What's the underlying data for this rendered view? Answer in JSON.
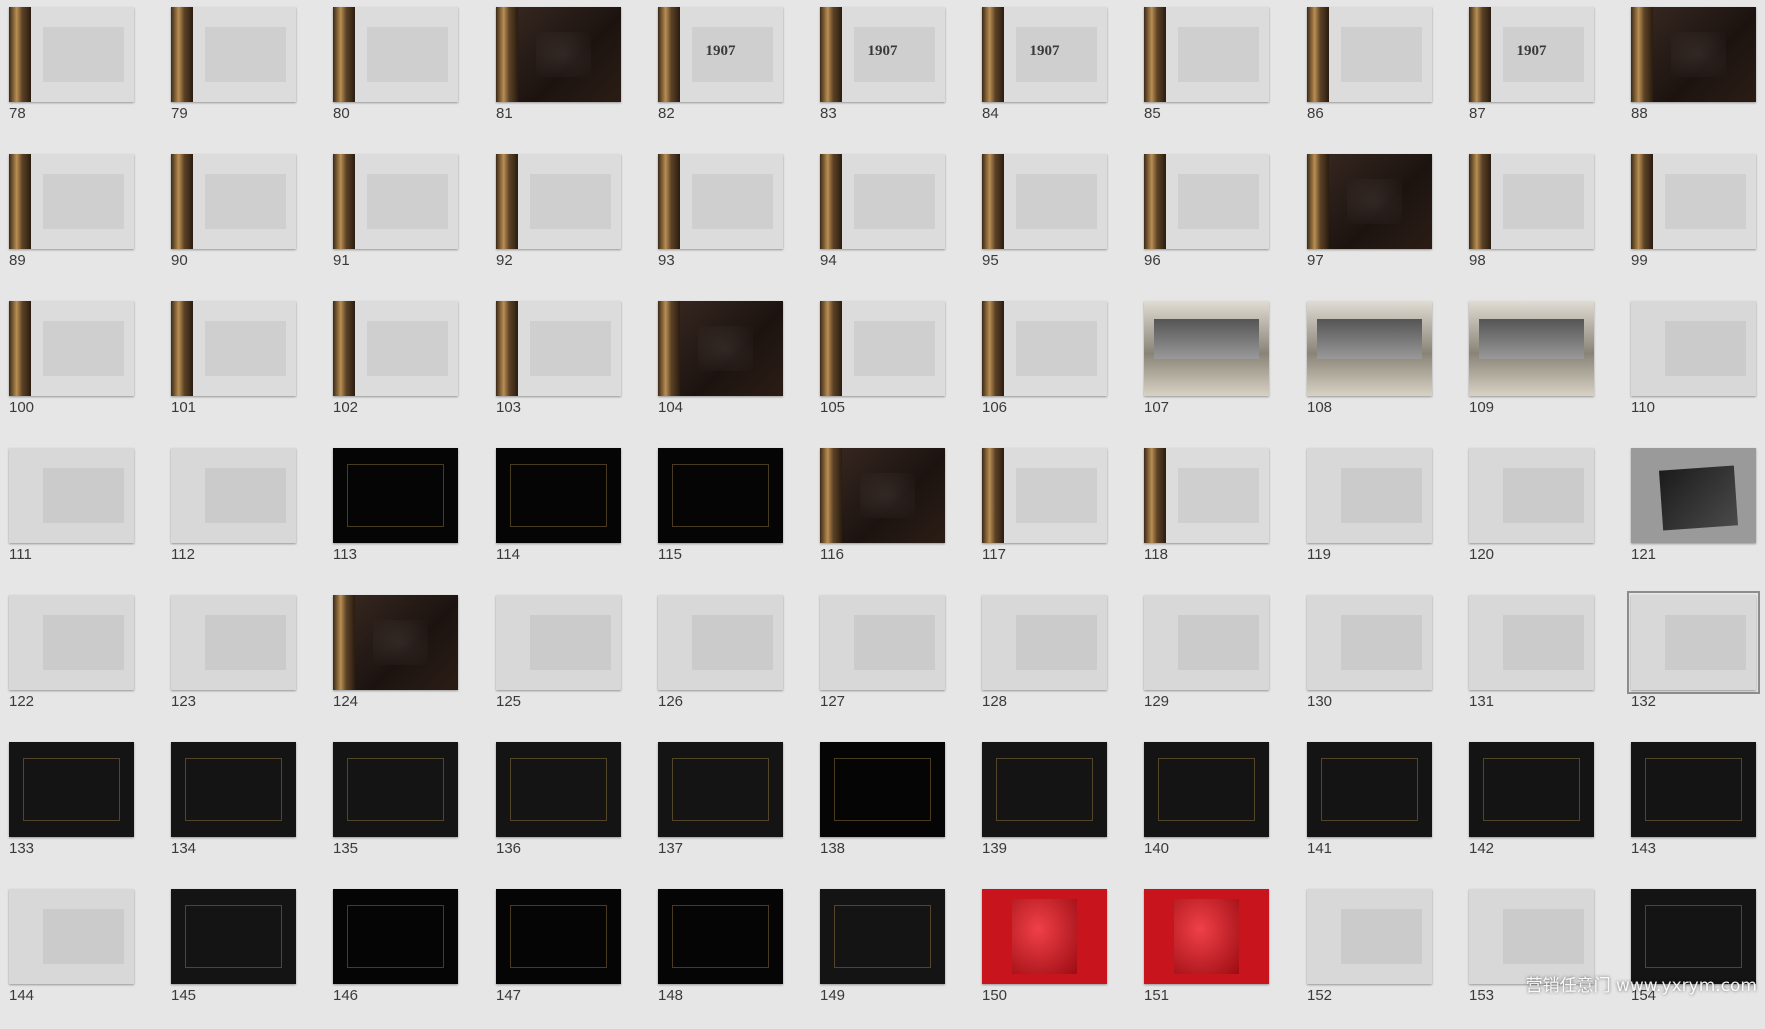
{
  "watermark": "营销任意门 www.yxrym.com",
  "selected": "132",
  "slides": [
    {
      "n": "78",
      "theme": "gold-light",
      "label": ""
    },
    {
      "n": "79",
      "theme": "gold-light",
      "label": ""
    },
    {
      "n": "80",
      "theme": "gold-light",
      "label": ""
    },
    {
      "n": "81",
      "theme": "gold-dark",
      "label": ""
    },
    {
      "n": "82",
      "theme": "gold-light",
      "label": "1907"
    },
    {
      "n": "83",
      "theme": "gold-light",
      "label": "1907"
    },
    {
      "n": "84",
      "theme": "gold-light",
      "label": "1907"
    },
    {
      "n": "85",
      "theme": "gold-light",
      "label": ""
    },
    {
      "n": "86",
      "theme": "gold-light",
      "label": ""
    },
    {
      "n": "87",
      "theme": "gold-light",
      "label": "1907"
    },
    {
      "n": "88",
      "theme": "gold-dark",
      "label": ""
    },
    {
      "n": "89",
      "theme": "gold-light",
      "label": ""
    },
    {
      "n": "90",
      "theme": "gold-light",
      "label": ""
    },
    {
      "n": "91",
      "theme": "gold-light",
      "label": ""
    },
    {
      "n": "92",
      "theme": "gold-light",
      "label": ""
    },
    {
      "n": "93",
      "theme": "gold-light",
      "label": ""
    },
    {
      "n": "94",
      "theme": "gold-light",
      "label": ""
    },
    {
      "n": "95",
      "theme": "gold-light",
      "label": ""
    },
    {
      "n": "96",
      "theme": "gold-light",
      "label": ""
    },
    {
      "n": "97",
      "theme": "gold-dark",
      "label": ""
    },
    {
      "n": "98",
      "theme": "gold-light",
      "label": ""
    },
    {
      "n": "99",
      "theme": "gold-light",
      "label": ""
    },
    {
      "n": "100",
      "theme": "gold-light",
      "label": ""
    },
    {
      "n": "101",
      "theme": "gold-light",
      "label": ""
    },
    {
      "n": "102",
      "theme": "gold-light",
      "label": ""
    },
    {
      "n": "103",
      "theme": "gold-light",
      "label": ""
    },
    {
      "n": "104",
      "theme": "gold-dark",
      "label": ""
    },
    {
      "n": "105",
      "theme": "gold-light",
      "label": ""
    },
    {
      "n": "106",
      "theme": "gold-light",
      "label": ""
    },
    {
      "n": "107",
      "theme": "city",
      "label": ""
    },
    {
      "n": "108",
      "theme": "city",
      "label": ""
    },
    {
      "n": "109",
      "theme": "city",
      "label": ""
    },
    {
      "n": "110",
      "theme": "light",
      "label": ""
    },
    {
      "n": "111",
      "theme": "light",
      "label": ""
    },
    {
      "n": "112",
      "theme": "light",
      "label": ""
    },
    {
      "n": "113",
      "theme": "black",
      "label": ""
    },
    {
      "n": "114",
      "theme": "black",
      "label": ""
    },
    {
      "n": "115",
      "theme": "black",
      "label": ""
    },
    {
      "n": "116",
      "theme": "gold-dark",
      "label": ""
    },
    {
      "n": "117",
      "theme": "gold-light",
      "label": ""
    },
    {
      "n": "118",
      "theme": "gold-light",
      "label": ""
    },
    {
      "n": "119",
      "theme": "light",
      "label": ""
    },
    {
      "n": "120",
      "theme": "light",
      "label": ""
    },
    {
      "n": "121",
      "theme": "grey",
      "label": ""
    },
    {
      "n": "122",
      "theme": "light",
      "label": ""
    },
    {
      "n": "123",
      "theme": "light",
      "label": ""
    },
    {
      "n": "124",
      "theme": "gold-dark",
      "label": ""
    },
    {
      "n": "125",
      "theme": "light",
      "label": ""
    },
    {
      "n": "126",
      "theme": "light",
      "label": ""
    },
    {
      "n": "127",
      "theme": "light",
      "label": ""
    },
    {
      "n": "128",
      "theme": "light",
      "label": ""
    },
    {
      "n": "129",
      "theme": "light",
      "label": ""
    },
    {
      "n": "130",
      "theme": "light",
      "label": ""
    },
    {
      "n": "131",
      "theme": "light",
      "label": ""
    },
    {
      "n": "132",
      "theme": "light",
      "label": ""
    },
    {
      "n": "133",
      "theme": "dark",
      "label": ""
    },
    {
      "n": "134",
      "theme": "dark",
      "label": ""
    },
    {
      "n": "135",
      "theme": "dark",
      "label": ""
    },
    {
      "n": "136",
      "theme": "dark",
      "label": ""
    },
    {
      "n": "137",
      "theme": "dark",
      "label": ""
    },
    {
      "n": "138",
      "theme": "black",
      "label": ""
    },
    {
      "n": "139",
      "theme": "dark",
      "label": ""
    },
    {
      "n": "140",
      "theme": "dark",
      "label": ""
    },
    {
      "n": "141",
      "theme": "dark",
      "label": ""
    },
    {
      "n": "142",
      "theme": "dark",
      "label": ""
    },
    {
      "n": "143",
      "theme": "dark",
      "label": ""
    },
    {
      "n": "144",
      "theme": "light",
      "label": ""
    },
    {
      "n": "145",
      "theme": "dark",
      "label": ""
    },
    {
      "n": "146",
      "theme": "black",
      "label": ""
    },
    {
      "n": "147",
      "theme": "black",
      "label": ""
    },
    {
      "n": "148",
      "theme": "black",
      "label": ""
    },
    {
      "n": "149",
      "theme": "dark",
      "label": ""
    },
    {
      "n": "150",
      "theme": "red",
      "label": ""
    },
    {
      "n": "151",
      "theme": "red",
      "label": ""
    },
    {
      "n": "152",
      "theme": "light",
      "label": ""
    },
    {
      "n": "153",
      "theme": "light",
      "label": ""
    },
    {
      "n": "154",
      "theme": "dark",
      "label": ""
    }
  ]
}
